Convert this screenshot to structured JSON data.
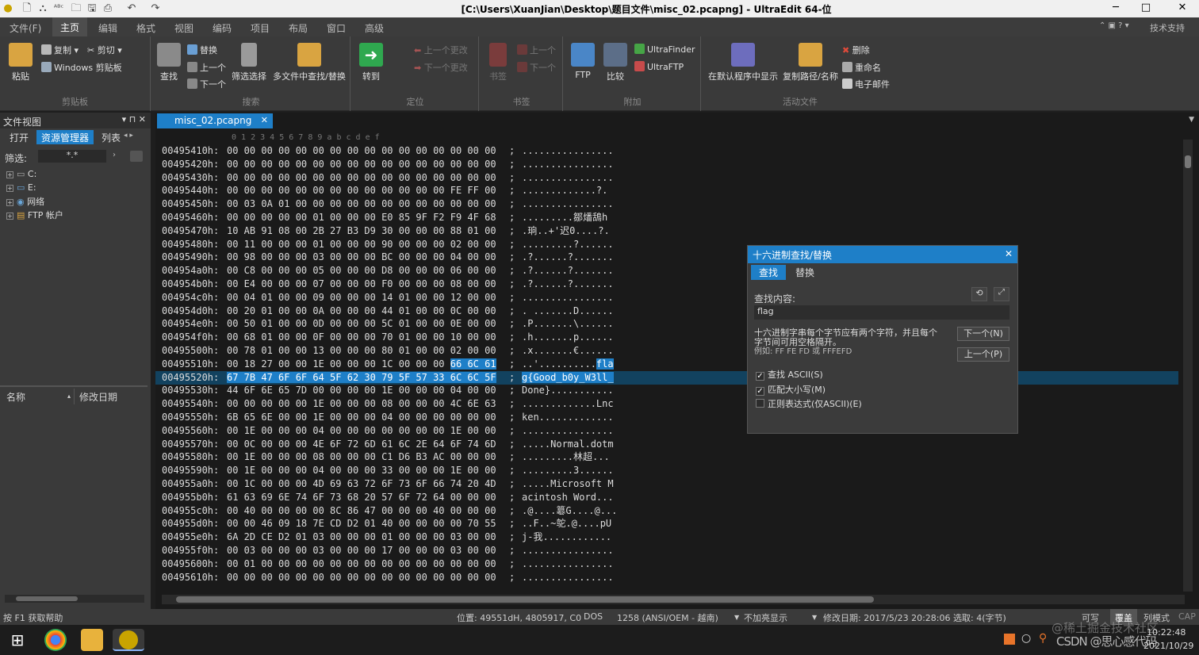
{
  "window": {
    "title": "[C:\\Users\\XuanJian\\Desktop\\题目文件\\misc_02.pcapng] - UltraEdit 64-位",
    "minimize": "─",
    "maximize": "□",
    "close": "✕"
  },
  "menu": {
    "file": "文件(F)",
    "tabs": [
      "主页",
      "编辑",
      "格式",
      "视图",
      "编码",
      "项目",
      "布局",
      "窗口",
      "高级"
    ],
    "active": "主页",
    "right": "技术支持"
  },
  "ribbon": {
    "clipboard": {
      "paste": "粘贴",
      "copy": "复制",
      "cut": "剪切",
      "windows_clipboard": "Windows 剪贴板",
      "group": "剪贴板"
    },
    "search": {
      "find": "查找",
      "replace": "替换",
      "prev": "上一个",
      "next": "下一个",
      "filter": "筛选选择",
      "multi": "多文件中查找/替换",
      "group": "搜索"
    },
    "navigate": {
      "goto": "转到",
      "prev_change": "上一个更改",
      "next_change": "下一个更改",
      "group": "定位"
    },
    "bookmarks": {
      "bookmark": "书签",
      "prev": "上一个",
      "next": "下一个",
      "group": "书签"
    },
    "extras": {
      "ftp": "FTP",
      "compare": "比较",
      "ultrafinder": "UltraFinder",
      "ultraftp": "UltraFTP",
      "group": "附加"
    },
    "active_file": {
      "open_default": "在默认程序中显示",
      "copy_path": "复制路径/名称",
      "delete": "删除",
      "rename": "重命名",
      "email": "电子邮件",
      "group": "活动文件"
    }
  },
  "left_pane": {
    "header": "文件视图",
    "tabs": [
      "打开",
      "资源管理器",
      "列表"
    ],
    "active_tab": "资源管理器",
    "filter_label": "筛选:",
    "filter_value": "*.*",
    "tree": [
      "C:",
      "E:",
      "网络",
      "FTP 帐户"
    ],
    "col_name": "名称",
    "col_date": "修改日期"
  },
  "editor": {
    "tab": "misc_02.pcapng",
    "ruler": "0  1  2  3  4  5  6  7  8  9  a  b  c  d  e  f",
    "lines": [
      {
        "a": "00495410h:",
        "h": "00 00 00 00 00 00 00 00 00 00 00 00 00 00 00 00",
        "t": "................"
      },
      {
        "a": "00495420h:",
        "h": "00 00 00 00 00 00 00 00 00 00 00 00 00 00 00 00",
        "t": "................"
      },
      {
        "a": "00495430h:",
        "h": "00 00 00 00 00 00 00 00 00 00 00 00 00 00 00 00",
        "t": "................"
      },
      {
        "a": "00495440h:",
        "h": "00 00 00 00 00 00 00 00 00 00 00 00 00 FE FF 00",
        "t": ".............?."
      },
      {
        "a": "00495450h:",
        "h": "00 03 0A 01 00 00 00 00 00 00 00 00 00 00 00 00",
        "t": "................"
      },
      {
        "a": "00495460h:",
        "h": "00 00 00 00 00 01 00 00 00 E0 85 9F F2 F9 4F 68",
        "t": ".........鄒燔鴰h"
      },
      {
        "a": "00495470h:",
        "h": "10 AB 91 08 00 2B 27 B3 D9 30 00 00 00 88 01 00",
        "t": ".珦..+'迟0....?."
      },
      {
        "a": "00495480h:",
        "h": "00 11 00 00 00 01 00 00 00 90 00 00 00 02 00 00",
        "t": ".........?......"
      },
      {
        "a": "00495490h:",
        "h": "00 98 00 00 00 03 00 00 00 BC 00 00 00 04 00 00",
        "t": ".?......?......."
      },
      {
        "a": "004954a0h:",
        "h": "00 C8 00 00 00 05 00 00 00 D8 00 00 00 06 00 00",
        "t": ".?......?......."
      },
      {
        "a": "004954b0h:",
        "h": "00 E4 00 00 00 07 00 00 00 F0 00 00 00 08 00 00",
        "t": ".?......?......."
      },
      {
        "a": "004954c0h:",
        "h": "00 04 01 00 00 09 00 00 00 14 01 00 00 12 00 00",
        "t": "................"
      },
      {
        "a": "004954d0h:",
        "h": "00 20 01 00 00 0A 00 00 00 44 01 00 00 0C 00 00",
        "t": ". .......D......"
      },
      {
        "a": "004954e0h:",
        "h": "00 50 01 00 00 0D 00 00 00 5C 01 00 00 0E 00 00",
        "t": ".P.......\\......"
      },
      {
        "a": "004954f0h:",
        "h": "00 68 01 00 00 0F 00 00 00 70 01 00 00 10 00 00",
        "t": ".h.......p......"
      },
      {
        "a": "00495500h:",
        "h": "00 78 01 00 00 13 00 00 00 80 01 00 00 02 00 00",
        "t": ".x.......€......"
      },
      {
        "a": "00495510h:",
        "h": "00 18 27 00 00 1E 00 00 00 1C 00 00 00 ",
        "hs": "66 6C 61",
        "t": "..'..........",
        "ts": "fla"
      },
      {
        "a": "00495520h:",
        "h": "",
        "hs": "67 7B 47 6F 6F 64 5F 62 30 79 5F 57 33 6C 6C 5F",
        "t": "",
        "ts": "g{Good_b0y_W3ll_",
        "cur": true
      },
      {
        "a": "00495530h:",
        "h": "44 6F 6E 65 7D 00 00 00 00 1E 00 00 00 04 00 00",
        "t": "Done}..........."
      },
      {
        "a": "00495540h:",
        "h": "00 00 00 00 00 1E 00 00 00 08 00 00 00 4C 6E 63",
        "t": ".............Lnc"
      },
      {
        "a": "00495550h:",
        "h": "6B 65 6E 00 00 1E 00 00 00 04 00 00 00 00 00 00",
        "t": "ken............."
      },
      {
        "a": "00495560h:",
        "h": "00 1E 00 00 00 04 00 00 00 00 00 00 00 1E 00 00",
        "t": "................"
      },
      {
        "a": "00495570h:",
        "h": "00 0C 00 00 00 4E 6F 72 6D 61 6C 2E 64 6F 74 6D",
        "t": ".....Normal.dotm"
      },
      {
        "a": "00495580h:",
        "h": "00 1E 00 00 00 08 00 00 00 C1 D6 B3 AC 00 00 00",
        "t": ".........林超..."
      },
      {
        "a": "00495590h:",
        "h": "00 1E 00 00 00 04 00 00 00 33 00 00 00 1E 00 00",
        "t": ".........3......"
      },
      {
        "a": "004955a0h:",
        "h": "00 1C 00 00 00 4D 69 63 72 6F 73 6F 66 74 20 4D",
        "t": ".....Microsoft M"
      },
      {
        "a": "004955b0h:",
        "h": "61 63 69 6E 74 6F 73 68 20 57 6F 72 64 00 00 00",
        "t": "acintosh Word..."
      },
      {
        "a": "004955c0h:",
        "h": "00 40 00 00 00 00 8C 86 47 00 00 00 40 00 00 00",
        "t": ".@....簒G....@..."
      },
      {
        "a": "004955d0h:",
        "h": "00 00 46 09 18 7E CD D2 01 40 00 00 00 00 70 55",
        "t": "..F..~鸵.@....pU"
      },
      {
        "a": "004955e0h:",
        "h": "6A 2D CE D2 01 03 00 00 00 01 00 00 00 03 00 00",
        "t": "j-我............"
      },
      {
        "a": "004955f0h:",
        "h": "00 03 00 00 00 03 00 00 00 17 00 00 00 03 00 00",
        "t": "................"
      },
      {
        "a": "00495600h:",
        "h": "00 01 00 00 00 00 00 00 00 00 00 00 00 00 00 00",
        "t": "................"
      },
      {
        "a": "00495610h:",
        "h": "00 00 00 00 00 00 00 00 00 00 00 00 00 00 00 00",
        "t": "................"
      }
    ]
  },
  "dialog": {
    "title": "十六进制查找/替换",
    "tabs": [
      "查找",
      "替换"
    ],
    "active_tab": "查找",
    "find_label": "查找内容:",
    "find_value": "flag",
    "hint1": "十六进制字串每个字节应有两个字符，并且每个",
    "hint2": "字节间可用空格隔开。",
    "example": "例如: FF FE FD 或 FFFEFD",
    "next_btn": "下一个(N)",
    "prev_btn": "上一个(P)",
    "options": [
      {
        "label": "查找 ASCII(S)",
        "checked": true
      },
      {
        "label": "匹配大小写(M)",
        "checked": true
      },
      {
        "label": "正则表达式(仅ASCII)(E)",
        "checked": false
      }
    ]
  },
  "status": {
    "help": "按 F1 获取帮助",
    "position": "位置: 49551dH, 4805917, C0",
    "format": "DOS",
    "encoding": "1258  (ANSI/OEM - 越南)",
    "highlight": "不加亮显示",
    "modified": "修改日期: 2017/5/23 20:28:06",
    "selection": "选取: 4(字节)",
    "writable": "可写",
    "overwrite": "覆盖",
    "column_mode": "列模式",
    "cap": "CAP"
  },
  "taskbar": {
    "time": "10:22:48",
    "date": "2021/10/29",
    "watermark1": "@稀土掘金技术社区",
    "watermark2": "CSDN @思心感代码"
  },
  "colors": {
    "accent": "#1e7fc8",
    "selection": "#1e7fc8",
    "current_line": "#12425f"
  }
}
